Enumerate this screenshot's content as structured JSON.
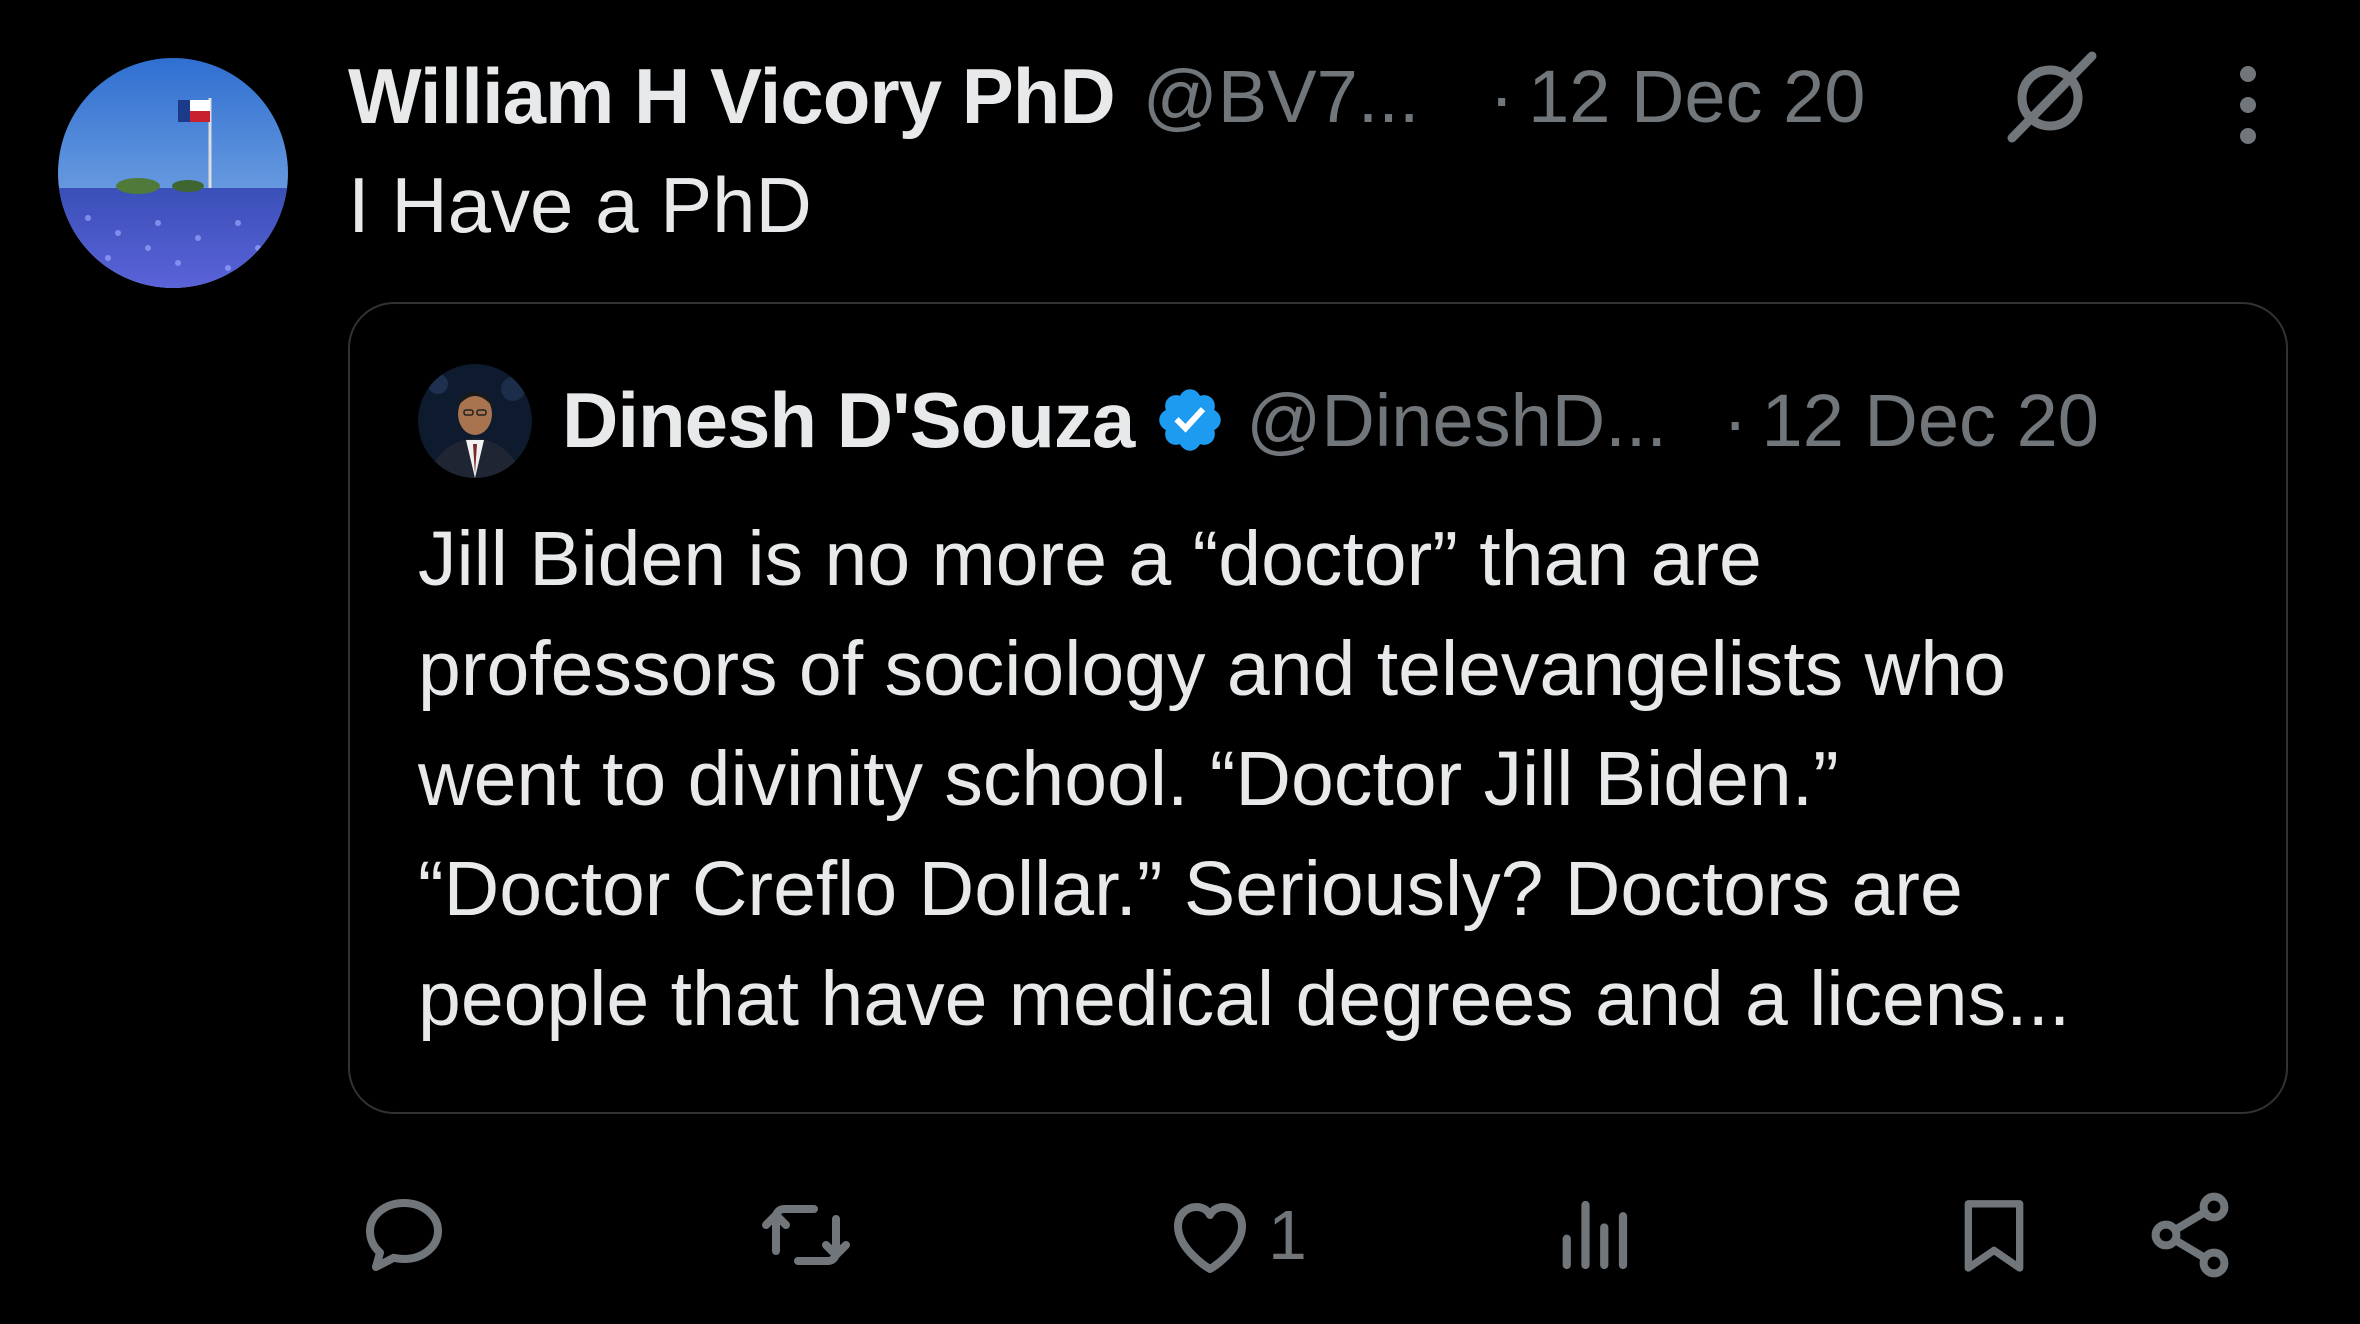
{
  "post": {
    "display_name": "William H Vicory PhD",
    "handle": "@BV7...",
    "separator": "·",
    "date": "12 Dec 20",
    "text": "I Have a PhD",
    "avatar_icon": "bluebonnet-field-avatar",
    "grok_icon": "grok-icon",
    "more_icon": "more-vertical-icon"
  },
  "quote": {
    "display_name": "Dinesh D'Souza",
    "verified": true,
    "verified_color": "#1d9bf0",
    "handle": "@DineshD...",
    "separator": "·",
    "date": "12 Dec 20",
    "lines": [
      "Jill Biden is no more a “doctor” than are",
      "professors of sociology and televangelists who",
      "went to divinity school. “Doctor Jill Biden.”",
      "“Doctor Creflo Dollar.” Seriously? Doctors are",
      "people that have medical degrees and a licens..."
    ]
  },
  "actions": {
    "reply_icon": "reply-icon",
    "repost_icon": "repost-icon",
    "like_icon": "heart-icon",
    "like_count": "1",
    "views_icon": "views-icon",
    "bookmark_icon": "bookmark-icon",
    "share_icon": "share-icon"
  },
  "colors": {
    "background": "#000000",
    "text_primary": "#e7e9ea",
    "text_secondary": "#71767b",
    "border": "#2f3336"
  }
}
